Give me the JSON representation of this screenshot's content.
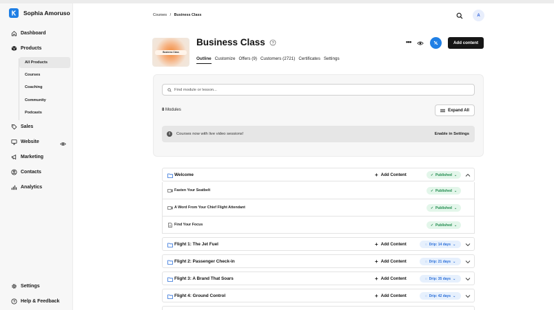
{
  "sidebar": {
    "brand_name": "Sophia Amoruso",
    "nav": {
      "dashboard": "Dashboard",
      "products": "Products",
      "sales": "Sales",
      "website": "Website",
      "marketing": "Marketing",
      "contacts": "Contacts",
      "analytics": "Analytics",
      "settings": "Settings",
      "help": "Help & Feedback"
    },
    "sub_items": [
      "All Products",
      "Courses",
      "Coaching",
      "Community",
      "Podcasts"
    ]
  },
  "header": {
    "breadcrumb_root": "Courses",
    "breadcrumb_sep": "/",
    "breadcrumb_current": "Business Class",
    "avatar_initial": "A"
  },
  "course": {
    "thumbnail_label": "Business Class",
    "title": "Business Class",
    "more": "•••",
    "add_content": "Add content",
    "tabs": [
      "Outline",
      "Customize",
      "Offers (9)",
      "Customers (2721)",
      "Certificates",
      "Settings"
    ]
  },
  "panel": {
    "search_placeholder": "Find module or lesson...",
    "modules_count": "8",
    "modules_word": "Modules",
    "expand_all": "Expand All",
    "notice_text": "Courses now with live video sessions!",
    "notice_link": "Enable in Settings"
  },
  "modules": {
    "welcome": {
      "title": "Welcome",
      "add": "Add Content",
      "status": "Published",
      "lessons": [
        {
          "title": "Fasten Your Seatbelt",
          "status": "Published"
        },
        {
          "title": "A Word From Your Chief Flight Attendant",
          "status": "Published"
        },
        {
          "title": "Find Your Focus",
          "status": "Published"
        }
      ]
    },
    "flights": [
      {
        "title": "Flight 1: The Jet Fuel",
        "add": "Add Content",
        "status": "Drip: 14 days"
      },
      {
        "title": "Flight 2: Passenger Check-in",
        "add": "Add Content",
        "status": "Drip: 21 days"
      },
      {
        "title": "Flight 3: A Brand That Soars",
        "add": "Add Content",
        "status": "Drip: 35 days"
      },
      {
        "title": "Flight 4: Ground Control",
        "add": "Add Content",
        "status": "Drip: 42 days"
      }
    ]
  },
  "colors": {
    "accent": "#1f7fe5",
    "published_bg": "#e3f6ea",
    "published_text": "#1f8a4c",
    "drip_bg": "#e6f0fd",
    "drip_text": "#2b6fd9"
  }
}
